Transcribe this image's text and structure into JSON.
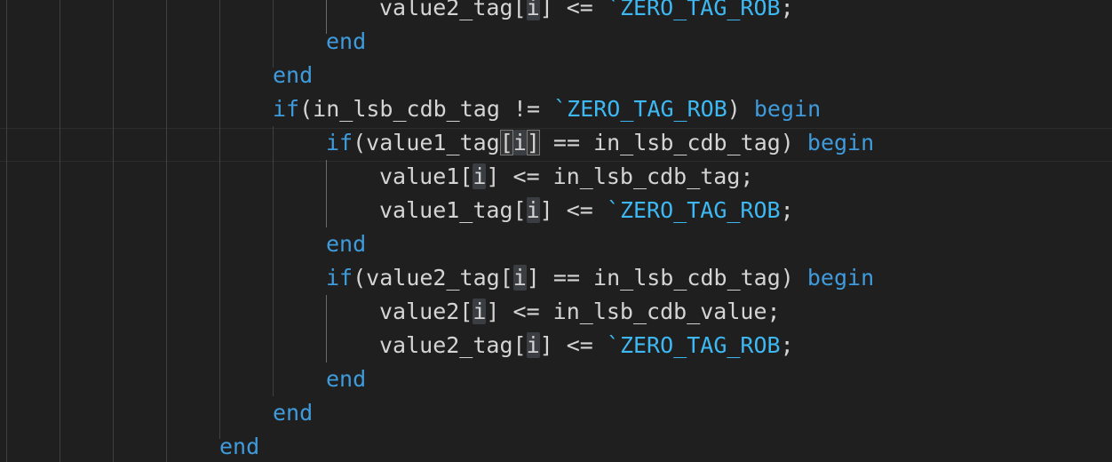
{
  "editor": {
    "language": "verilog",
    "colors": {
      "background": "#1f1f1f",
      "keyword": "#3f9bdc",
      "macro": "#3db8f2",
      "text": "#d4d4d4",
      "highlight": "#3a3d41"
    },
    "lines": [
      {
        "indent": 7,
        "tokens": [
          {
            "t": "value2_tag[",
            "c": "id"
          },
          {
            "t": "i",
            "c": "hl"
          },
          {
            "t": "] <= ",
            "c": "id"
          },
          {
            "t": "`ZERO_TAG_ROB",
            "c": "macro"
          },
          {
            "t": ";",
            "c": "id"
          }
        ]
      },
      {
        "indent": 6,
        "tokens": [
          {
            "t": "end",
            "c": "kw"
          }
        ]
      },
      {
        "indent": 5,
        "tokens": [
          {
            "t": "end",
            "c": "kw"
          }
        ]
      },
      {
        "indent": 5,
        "tokens": [
          {
            "t": "if",
            "c": "kw"
          },
          {
            "t": "(in_lsb_cdb_tag != ",
            "c": "id"
          },
          {
            "t": "`ZERO_TAG_ROB",
            "c": "macro"
          },
          {
            "t": ") ",
            "c": "id"
          },
          {
            "t": "begin",
            "c": "kw"
          }
        ]
      },
      {
        "indent": 6,
        "tokens": [
          {
            "t": "if",
            "c": "kw"
          },
          {
            "t": "(value1_tag",
            "c": "id"
          },
          {
            "t": "[",
            "c": "box"
          },
          {
            "t": "i",
            "c": "hl"
          },
          {
            "t": "]",
            "c": "box"
          },
          {
            "t": " == in_lsb_cdb_tag) ",
            "c": "id"
          },
          {
            "t": "begin",
            "c": "kw"
          }
        ]
      },
      {
        "indent": 7,
        "tokens": [
          {
            "t": "value1[",
            "c": "id"
          },
          {
            "t": "i",
            "c": "hl"
          },
          {
            "t": "] <= in_lsb_cdb_tag;",
            "c": "id"
          }
        ]
      },
      {
        "indent": 7,
        "tokens": [
          {
            "t": "value1_tag[",
            "c": "id"
          },
          {
            "t": "i",
            "c": "hl"
          },
          {
            "t": "] <= ",
            "c": "id"
          },
          {
            "t": "`ZERO_TAG_ROB",
            "c": "macro"
          },
          {
            "t": ";",
            "c": "id"
          }
        ]
      },
      {
        "indent": 6,
        "tokens": [
          {
            "t": "end",
            "c": "kw"
          }
        ]
      },
      {
        "indent": 6,
        "tokens": [
          {
            "t": "if",
            "c": "kw"
          },
          {
            "t": "(value2_tag[",
            "c": "id"
          },
          {
            "t": "i",
            "c": "hl"
          },
          {
            "t": "] == in_lsb_cdb_tag) ",
            "c": "id"
          },
          {
            "t": "begin",
            "c": "kw"
          }
        ]
      },
      {
        "indent": 7,
        "tokens": [
          {
            "t": "value2[",
            "c": "id"
          },
          {
            "t": "i",
            "c": "hl"
          },
          {
            "t": "] <= in_lsb_cdb_value;",
            "c": "id"
          }
        ]
      },
      {
        "indent": 7,
        "tokens": [
          {
            "t": "value2_tag[",
            "c": "id"
          },
          {
            "t": "i",
            "c": "hl"
          },
          {
            "t": "] <= ",
            "c": "id"
          },
          {
            "t": "`ZERO_TAG_ROB",
            "c": "macro"
          },
          {
            "t": ";",
            "c": "id"
          }
        ]
      },
      {
        "indent": 6,
        "tokens": [
          {
            "t": "end",
            "c": "kw"
          }
        ]
      },
      {
        "indent": 5,
        "tokens": [
          {
            "t": "end",
            "c": "kw"
          }
        ]
      },
      {
        "indent": 4,
        "tokens": [
          {
            "t": "end",
            "c": "kw"
          }
        ]
      }
    ]
  }
}
